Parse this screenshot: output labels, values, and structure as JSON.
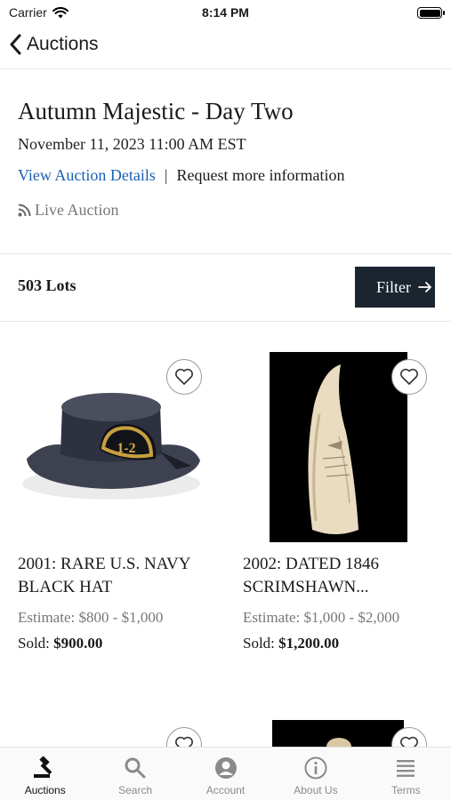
{
  "status": {
    "carrier": "Carrier",
    "time": "8:14 PM"
  },
  "nav": {
    "back_label": "Auctions"
  },
  "auction": {
    "title": "Autumn Majestic - Day Two",
    "date": "November 11, 2023 11:00 AM EST",
    "details_link": "View Auction Details",
    "separator": "|",
    "info_link": "Request more information",
    "live_label": "Live Auction"
  },
  "lots_bar": {
    "count_label": "503 Lots",
    "filter_label": "Filter"
  },
  "lots": [
    {
      "title": "2001: RARE U.S. NAVY BLACK HAT",
      "estimate": "Estimate: $800 - $1,000",
      "sold_prefix": "Sold:",
      "sold_value": "$900.00",
      "hat_text": "1-2"
    },
    {
      "title": "2002: DATED 1846 SCRIMSHAWN...",
      "estimate": "Estimate: $1,000 - $2,000",
      "sold_prefix": "Sold:",
      "sold_value": "$1,200.00"
    }
  ],
  "tabs": [
    {
      "label": "Auctions",
      "icon": "gavel-icon",
      "active": true
    },
    {
      "label": "Search",
      "icon": "search-icon",
      "active": false
    },
    {
      "label": "Account",
      "icon": "account-icon",
      "active": false
    },
    {
      "label": "About Us",
      "icon": "info-icon",
      "active": false
    },
    {
      "label": "Terms",
      "icon": "list-icon",
      "active": false
    }
  ],
  "colors": {
    "accent_link": "#1a5fb4",
    "filter_bg": "#1b2530",
    "muted": "#777777"
  }
}
